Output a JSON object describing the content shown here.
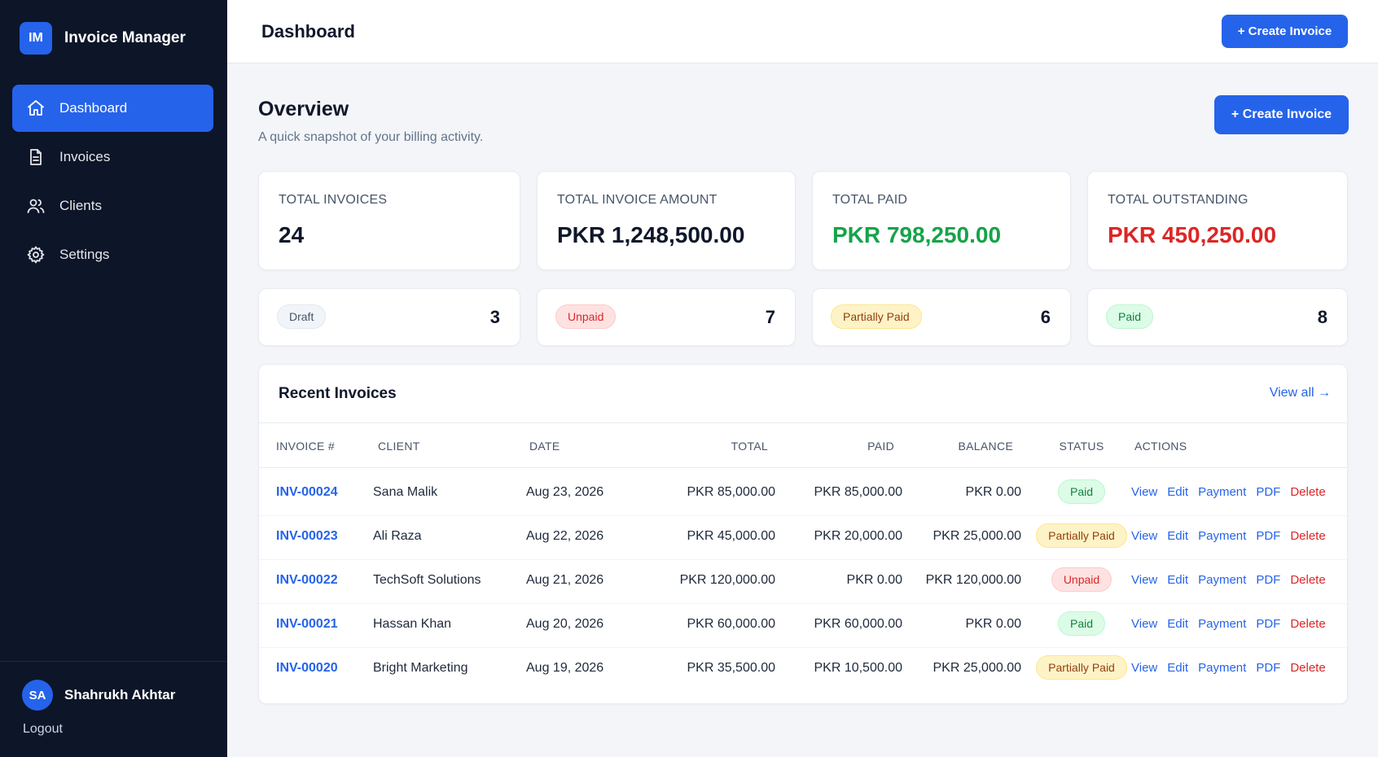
{
  "sidebar": {
    "logo": "IM",
    "app_name": "Invoice Manager",
    "items": [
      {
        "label": "Dashboard",
        "icon": "home-icon"
      },
      {
        "label": "Invoices",
        "icon": "document-icon"
      },
      {
        "label": "Clients",
        "icon": "users-icon"
      },
      {
        "label": "Settings",
        "icon": "gear-icon"
      }
    ],
    "user": {
      "initials": "SA",
      "name": "Shahrukh Akhtar"
    },
    "logout": "Logout"
  },
  "header": {
    "title": "Dashboard",
    "create_label": "+ Create Invoice"
  },
  "overview": {
    "title": "Overview",
    "subtitle": "A quick snapshot of your billing activity.",
    "create_label": "+ Create Invoice"
  },
  "stats": [
    {
      "label": "TOTAL INVOICES",
      "value": "24",
      "color": "#0f172a"
    },
    {
      "label": "TOTAL INVOICE AMOUNT",
      "value": "PKR 1,248,500.00",
      "color": "#0f172a"
    },
    {
      "label": "TOTAL PAID",
      "value": "PKR 798,250.00",
      "color": "#16a34a"
    },
    {
      "label": "TOTAL OUTSTANDING",
      "value": "PKR 450,250.00",
      "color": "#dc2626"
    }
  ],
  "status_counts": [
    {
      "label": "Draft",
      "count": "3"
    },
    {
      "label": "Unpaid",
      "count": "7"
    },
    {
      "label": "Partially Paid",
      "count": "6"
    },
    {
      "label": "Paid",
      "count": "8"
    }
  ],
  "recent": {
    "title": "Recent Invoices",
    "view_all": "View all →",
    "columns": [
      "INVOICE #",
      "CLIENT",
      "DATE",
      "TOTAL",
      "PAID",
      "BALANCE",
      "STATUS",
      "ACTIONS"
    ],
    "action_labels": [
      "View",
      "Edit",
      "Payment",
      "PDF",
      "Delete"
    ],
    "rows": [
      {
        "id": "INV-00024",
        "client": "Sana Malik",
        "date": "Aug 23, 2026",
        "total": "PKR 85,000.00",
        "paid": "PKR 85,000.00",
        "balance": "PKR 0.00",
        "status": "Paid"
      },
      {
        "id": "INV-00023",
        "client": "Ali Raza",
        "date": "Aug 22, 2026",
        "total": "PKR 45,000.00",
        "paid": "PKR 20,000.00",
        "balance": "PKR 25,000.00",
        "status": "Partially Paid"
      },
      {
        "id": "INV-00022",
        "client": "TechSoft Solutions",
        "date": "Aug 21, 2026",
        "total": "PKR 120,000.00",
        "paid": "PKR 0.00",
        "balance": "PKR 120,000.00",
        "status": "Unpaid"
      },
      {
        "id": "INV-00021",
        "client": "Hassan Khan",
        "date": "Aug 20, 2026",
        "total": "PKR 60,000.00",
        "paid": "PKR 60,000.00",
        "balance": "PKR 0.00",
        "status": "Paid"
      },
      {
        "id": "INV-00020",
        "client": "Bright Marketing",
        "date": "Aug 19, 2026",
        "total": "PKR 35,500.00",
        "paid": "PKR 10,500.00",
        "balance": "PKR 25,000.00",
        "status": "Partially Paid"
      }
    ]
  },
  "colors": {
    "accent": "#2563eb",
    "sidebar_bg": "#0d1528",
    "paid": "#16a34a",
    "outstanding": "#dc2626"
  }
}
